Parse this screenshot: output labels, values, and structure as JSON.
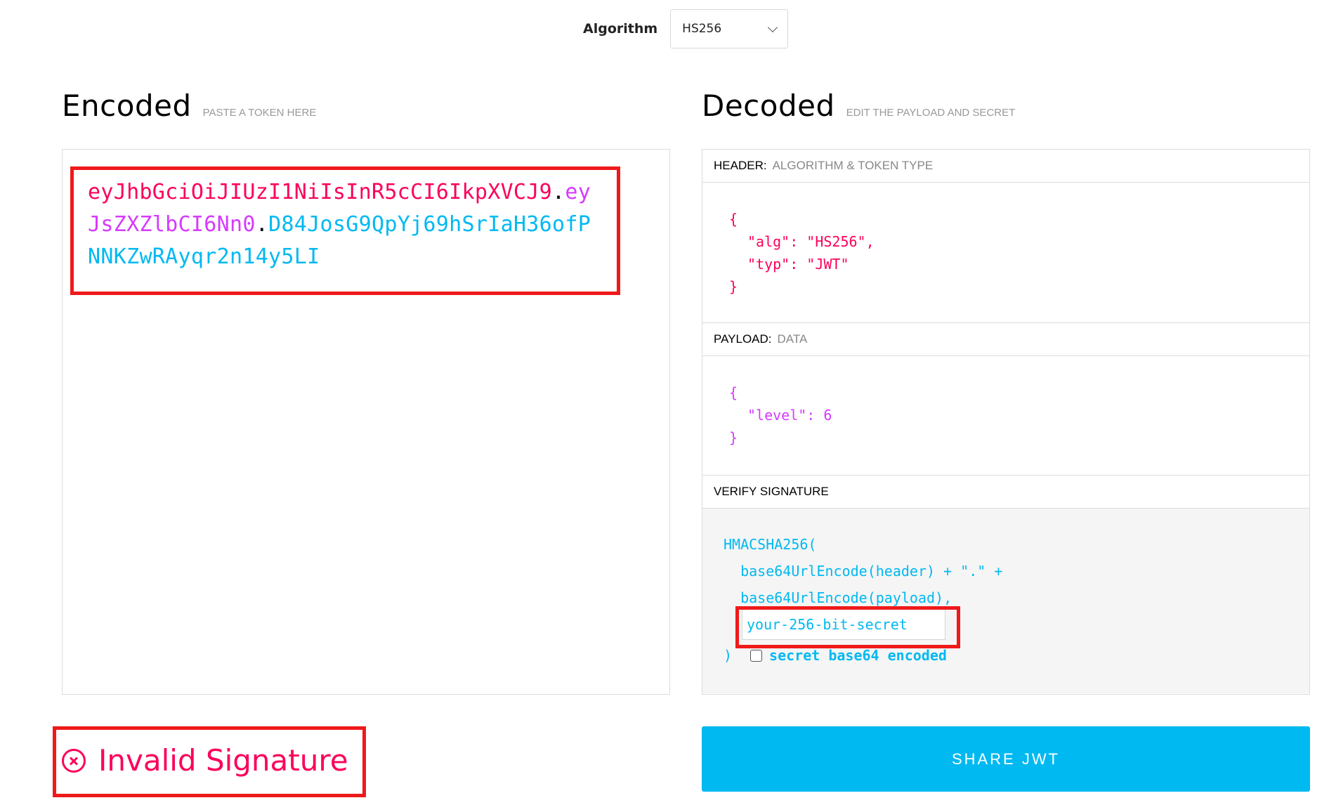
{
  "algorithm": {
    "label": "Algorithm",
    "selected": "HS256"
  },
  "encoded": {
    "title": "Encoded",
    "hint": "PASTE A TOKEN HERE",
    "token": {
      "header": "eyJhbGciOiJIUzI1NiIsInR5cCI6IkpXVCJ9",
      "dot1": ".",
      "payload": "eyJsZXZlbCI6Nn0",
      "dot2": ".",
      "signature": "D84JosG9QpYj69hSrIaH36ofPNNKZwRAyqr2n14y5LI"
    }
  },
  "decoded": {
    "title": "Decoded",
    "hint": "EDIT THE PAYLOAD AND SECRET",
    "header_section": {
      "key": "HEADER:",
      "value": "ALGORITHM & TOKEN TYPE",
      "open": "{",
      "line1": "\"alg\": \"HS256\",",
      "line2": "\"typ\": \"JWT\"",
      "close": "}"
    },
    "payload_section": {
      "key": "PAYLOAD:",
      "value": "DATA",
      "open": "{",
      "line1": "\"level\": 6",
      "close": "}"
    },
    "verify_section": {
      "key": "VERIFY SIGNATURE",
      "line1": "HMACSHA256(",
      "line2": "  base64UrlEncode(header) + \".\" +",
      "line3": "  base64UrlEncode(payload),",
      "secret_value": "your-256-bit-secret",
      "close": ")",
      "checkbox_label": "secret base64 encoded",
      "checkbox_checked": false
    }
  },
  "status": {
    "text": "Invalid Signature",
    "icon": "x-circle-icon",
    "color": "#fb015b"
  },
  "share_button": {
    "label": "SHARE JWT",
    "color": "#00b9f1"
  },
  "colors": {
    "header": "#fb015b",
    "payload": "#d63aff",
    "signature": "#00b9f1",
    "highlight": "#ef1a1a"
  }
}
